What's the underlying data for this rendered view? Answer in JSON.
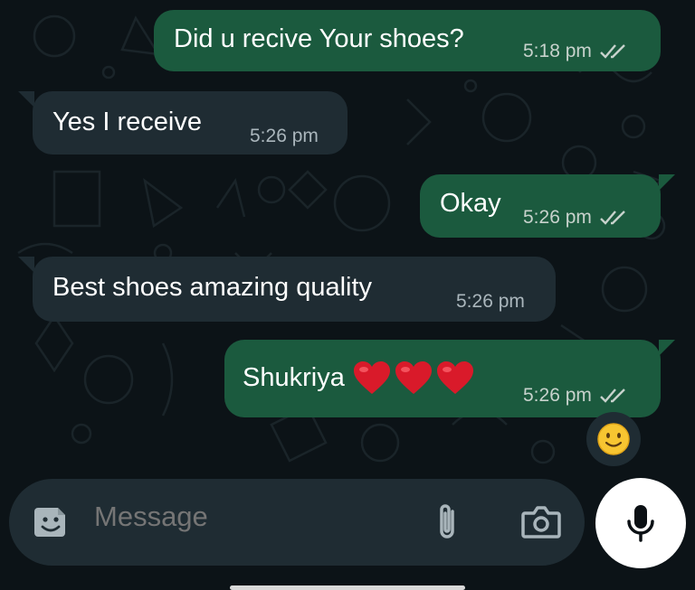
{
  "messages": [
    {
      "direction": "outgoing",
      "text": "Did u recive Your shoes?",
      "time": "5:18 pm",
      "status": "read"
    },
    {
      "direction": "incoming",
      "text": "Yes I receive",
      "time": "5:26 pm"
    },
    {
      "direction": "outgoing",
      "text": "Okay",
      "time": "5:26 pm",
      "status": "read"
    },
    {
      "direction": "incoming",
      "text": "Best shoes amazing quality",
      "time": "5:26 pm"
    },
    {
      "direction": "outgoing",
      "text": "Shukriya",
      "emoji": [
        "red-heart",
        "red-heart",
        "red-heart"
      ],
      "time": "5:26 pm",
      "status": "read"
    }
  ],
  "reaction": {
    "icon": "smiling-face-emoji"
  },
  "composer": {
    "placeholder": "Message",
    "icons": [
      "sticker-icon",
      "attach-icon",
      "camera-icon",
      "mic-icon"
    ]
  },
  "colors": {
    "background": "#0c1317",
    "outgoing_bubble": "#1b5a3e",
    "incoming_bubble": "#1f2c33",
    "read_ticks": "#c7d2cc"
  }
}
